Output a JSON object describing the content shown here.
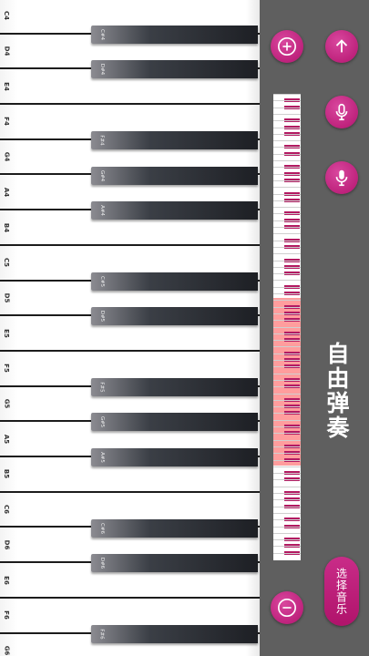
{
  "white_keys": [
    "C4",
    "D4",
    "E4",
    "F4",
    "G4",
    "A4",
    "B4",
    "C5",
    "D5",
    "E5",
    "F5",
    "G5",
    "A5",
    "B5",
    "C6",
    "D6",
    "E6",
    "F6",
    "G6"
  ],
  "black_keys": [
    "C#4",
    "D#4",
    "F#4",
    "G#4",
    "A#4",
    "C#5",
    "D#5",
    "F#5",
    "G#5",
    "A#5",
    "C#6",
    "D#6",
    "F#6"
  ],
  "black_key_slots": [
    1,
    2,
    4,
    5,
    6,
    8,
    9,
    11,
    12,
    13,
    15,
    16,
    18
  ],
  "title": "自由弹奏",
  "select_music_label": "选择音乐",
  "colors": {
    "accent": "#c2197f",
    "background": "#5f5f5f",
    "minimap_highlight": "#ff8a8a",
    "minimap_black": "#b31a62"
  },
  "icons": {
    "zoom_in": "plus-circle-icon",
    "zoom_out": "minus-circle-icon",
    "up": "arrow-up-icon",
    "record": "microphone-icon",
    "record_playback": "microphone-record-icon"
  }
}
